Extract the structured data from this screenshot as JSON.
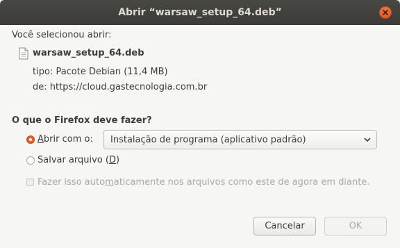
{
  "window": {
    "title": "Abrir “warsaw_setup_64.deb”"
  },
  "dialog": {
    "intro": "Você selecionou abrir:",
    "file": {
      "name": "warsaw_setup_64.deb",
      "type_label": "tipo:",
      "type_value": "Pacote Debian (11,4 MB)",
      "from_label": "de:",
      "from_value": "https://cloud.gastecnologia.com.br",
      "icon": "document-icon"
    },
    "question": "O que o Firefox deve fazer?",
    "options": {
      "open_with": {
        "prefix": "",
        "mnemonic": "A",
        "rest": "brir com o:",
        "selected": true
      },
      "app_select": {
        "value": "Instalação de programa (aplicativo padrão)"
      },
      "save_file": {
        "text": "Salvar arquivo (",
        "mnemonic": "D",
        "suffix": ")",
        "selected": false
      }
    },
    "auto_checkbox": {
      "before": "Fazer isso auto",
      "mnemonic": "m",
      "after": "aticamente nos arquivos como este de agora em diante.",
      "checked": false,
      "enabled": false
    }
  },
  "buttons": {
    "cancel": "Cancelar",
    "ok": "OK"
  },
  "colors": {
    "titlebar": "#3c3b37",
    "accent": "#e8612c",
    "background": "#f6f6f5"
  }
}
